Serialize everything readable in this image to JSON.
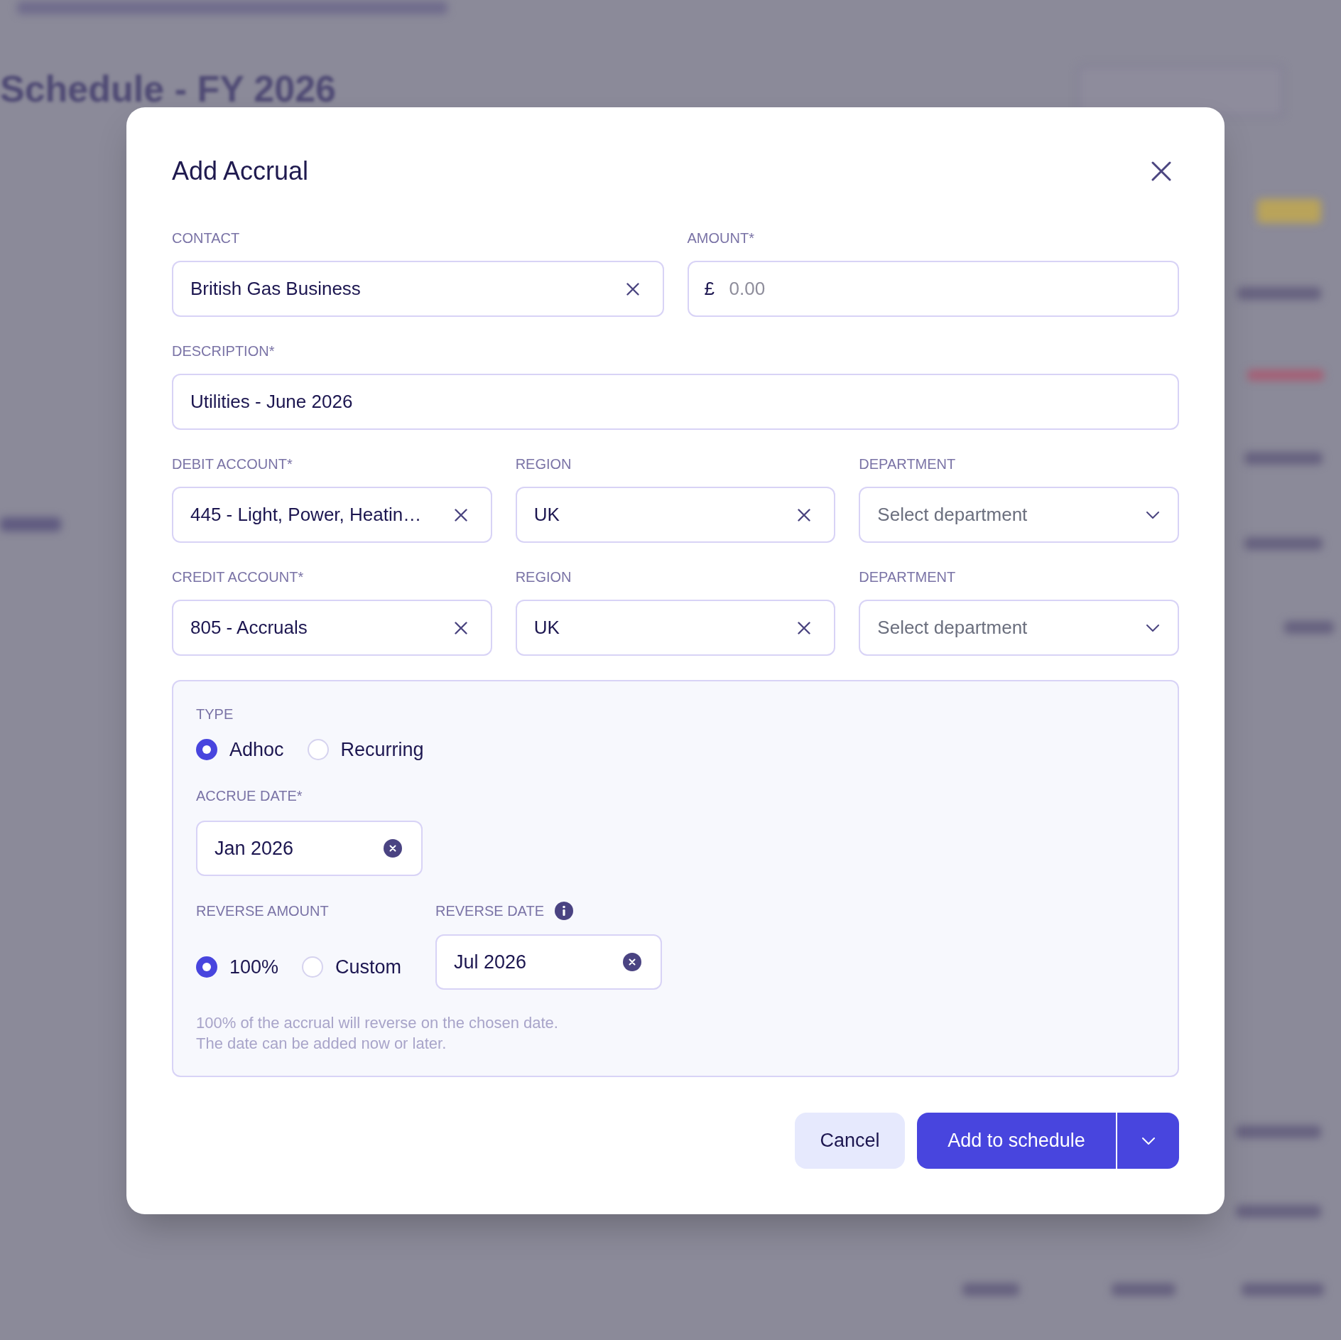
{
  "background": {
    "page_title": "Schedule - FY 2026"
  },
  "dialog": {
    "title": "Add Accrual",
    "rows": [
      [
        {
          "kind": "combo",
          "label": "CONTACT",
          "value": "British Gas Business"
        },
        {
          "kind": "currency",
          "label": "AMOUNT*",
          "prefix": "£",
          "placeholder": "0.00"
        }
      ],
      [
        {
          "kind": "text",
          "label": "DESCRIPTION*",
          "value": "Utilities - June 2026"
        }
      ],
      [
        {
          "kind": "combo",
          "label": "DEBIT ACCOUNT*",
          "value": "445 - Light, Power, Heatin…"
        },
        {
          "kind": "combo",
          "label": "REGION",
          "value": "UK"
        },
        {
          "kind": "dropdown",
          "label": "DEPARTMENT",
          "placeholder": "Select department"
        }
      ],
      [
        {
          "kind": "combo",
          "label": "CREDIT ACCOUNT*",
          "value": "805 - Accruals"
        },
        {
          "kind": "combo",
          "label": "REGION",
          "value": "UK"
        },
        {
          "kind": "dropdown",
          "label": "DEPARTMENT",
          "placeholder": "Select department"
        }
      ]
    ],
    "type_panel": {
      "type": {
        "label": "TYPE",
        "options": [
          {
            "label": "Adhoc",
            "selected": true
          },
          {
            "label": "Recurring",
            "selected": false
          }
        ]
      },
      "accrue_date": {
        "label": "ACCRUE DATE*",
        "value": "Jan 2026"
      },
      "reverse_amount": {
        "label": "REVERSE AMOUNT",
        "options": [
          {
            "label": "100%",
            "selected": true
          },
          {
            "label": "Custom",
            "selected": false
          }
        ]
      },
      "reverse_date": {
        "label": "REVERSE DATE",
        "info": true,
        "value": "Jul 2026"
      },
      "help_text": [
        "100% of the accrual will reverse on the chosen date.",
        "The date can be added now or later."
      ]
    },
    "buttons": [
      {
        "kind": "secondary",
        "label": "Cancel"
      },
      {
        "kind": "split",
        "label": "Add to schedule"
      }
    ]
  }
}
